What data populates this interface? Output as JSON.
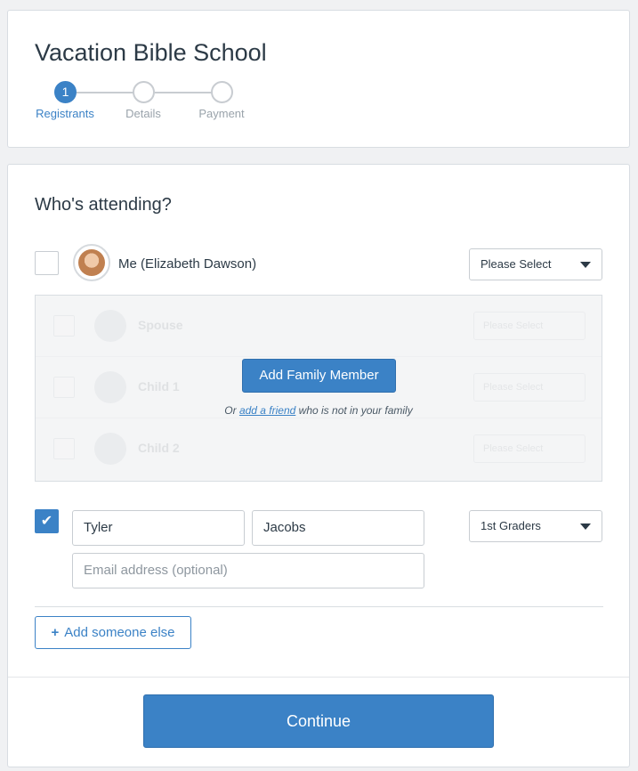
{
  "header": {
    "title": "Vacation Bible School",
    "steps": [
      {
        "number": "1",
        "label": "Registrants",
        "active": true
      },
      {
        "number": "",
        "label": "Details",
        "active": false
      },
      {
        "number": "",
        "label": "Payment",
        "active": false
      }
    ]
  },
  "main": {
    "section_title": "Who's attending?",
    "me": {
      "name": "Me (Elizabeth Dawson)",
      "select_value": "Please Select",
      "checked": false
    },
    "family": {
      "rows": [
        {
          "name": "Spouse",
          "select_value": "Please Select"
        },
        {
          "name": "Child 1",
          "select_value": "Please Select"
        },
        {
          "name": "Child 2",
          "select_value": "Please Select"
        }
      ],
      "add_button_label": "Add Family Member",
      "or_prefix": "Or",
      "add_friend_link": "add a friend",
      "or_suffix": "who is not in your family"
    },
    "guest": {
      "checked": true,
      "first_name": "Tyler",
      "last_name": "Jacobs",
      "email_placeholder": "Email address (optional)",
      "select_value": "1st Graders"
    },
    "add_someone_label": "Add someone else",
    "continue_label": "Continue"
  },
  "colors": {
    "accent": "#3b82c6",
    "text": "#2c3a46",
    "border": "#c8cdd2",
    "background": "#f0f1f3"
  }
}
